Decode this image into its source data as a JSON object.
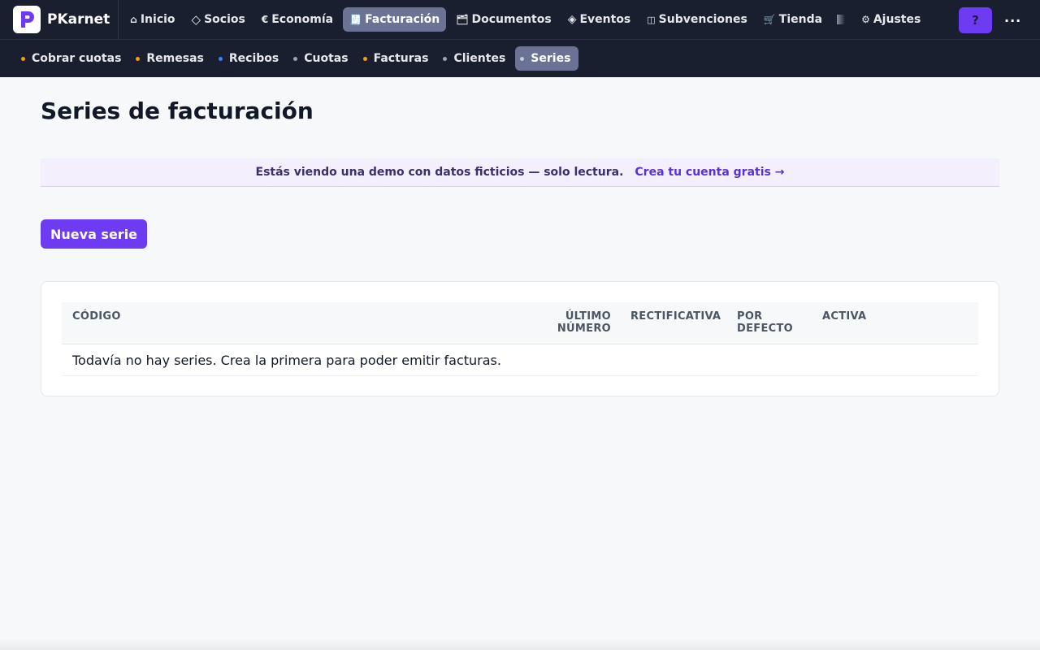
{
  "app": {
    "brand_name": "PKarnet",
    "help_label": "?",
    "more_label": "..."
  },
  "nav": {
    "items": [
      {
        "label": "Inicio",
        "icon": "home-icon",
        "active": false
      },
      {
        "label": "Socios",
        "icon": "diamond-icon",
        "active": false
      },
      {
        "label": "Economía",
        "icon": "euro-icon",
        "active": false
      },
      {
        "label": "Facturación",
        "icon": "invoice-icon",
        "active": true
      },
      {
        "label": "Documentos",
        "icon": "folder-icon",
        "active": false
      },
      {
        "label": "Eventos",
        "icon": "event-diamond-icon",
        "active": false
      },
      {
        "label": "Subvenciones",
        "icon": "book-icon",
        "active": false
      },
      {
        "label": "Tienda",
        "icon": "cart-icon",
        "active": false
      },
      {
        "label": "Ajustes",
        "icon": "gear-icon",
        "active": false
      }
    ],
    "icons": {
      "home": "⌂",
      "diamond": "◇",
      "euro": "€",
      "invoice": "🧾",
      "folder": "🗂",
      "event": "◈",
      "book": "◫",
      "cart": "🛒",
      "gear": "⚙"
    }
  },
  "subnav": {
    "items": [
      {
        "label": "Cobrar cuotas",
        "dot_color": "#f59e0b",
        "active": false
      },
      {
        "label": "Remesas",
        "dot_color": "#f59e0b",
        "active": false
      },
      {
        "label": "Recibos",
        "dot_color": "#3b82f6",
        "active": false
      },
      {
        "label": "Cuotas",
        "dot_color": "#9ca3af",
        "active": false
      },
      {
        "label": "Facturas",
        "dot_color": "#f59e0b",
        "active": false
      },
      {
        "label": "Clientes",
        "dot_color": "#9ca3af",
        "active": false
      },
      {
        "label": "Series",
        "dot_color": "#c7cbe0",
        "active": true
      }
    ]
  },
  "page": {
    "title": "Series de facturación"
  },
  "banner": {
    "text": "Estás viendo una demo con datos ficticios — solo lectura.",
    "link_label": "Crea tu cuenta gratis →"
  },
  "actions": {
    "new_series_label": "Nueva serie"
  },
  "table": {
    "columns": {
      "code": "CÓDIGO",
      "last_number_line1": "ÚLTIMO",
      "last_number_line2": "NÚMERO",
      "rectifying": "RECTIFICATIVA",
      "default_line1": "POR",
      "default_line2": "DEFECTO",
      "active": "ACTIVA"
    },
    "empty_message": "Todavía no hay series. Crea la primera para poder emitir facturas."
  },
  "colors": {
    "nav_bg": "#1a1f30",
    "nav_active_bg": "#6b7394",
    "accent": "#6d3cf2",
    "banner_bg": "#f3effd"
  }
}
